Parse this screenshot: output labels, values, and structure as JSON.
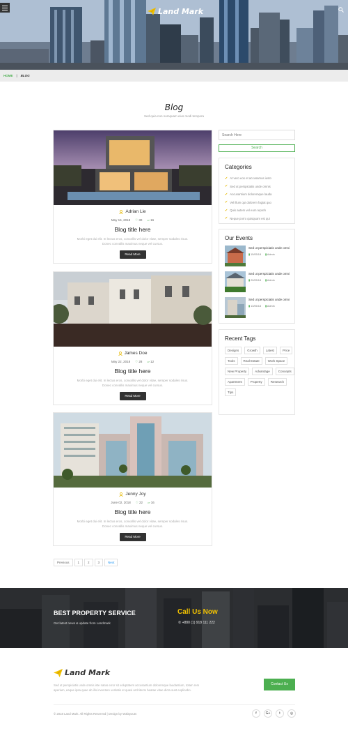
{
  "header": {
    "logo_text": "Land Mark",
    "menu_icon": "hamburger-icon",
    "search_icon": "search-icon"
  },
  "breadcrumb": {
    "home": "HOME",
    "separator": "|",
    "current": "BLOG"
  },
  "page": {
    "title": "Blog",
    "subtitle": "Sed quia non numquam eius modi tempora"
  },
  "posts": [
    {
      "author": "Adrian Lie",
      "date": "May 15, 2018",
      "likes": "30",
      "comments": "16",
      "title": "Blog title here",
      "excerpt": "Morbi eget dui elit. In lectus eros, convallis vel dolor vitae, semper sodales risus. Donec convallis maximus neque vel cursus.",
      "read_more": "Read More"
    },
    {
      "author": "James Doe",
      "date": "May 22, 2018",
      "likes": "28",
      "comments": "12",
      "title": "Blog title here",
      "excerpt": "Morbi eget dui elit. In lectus eros, convallis vel dolor vitae, semper sodales risus. Donec convallis maximus neque vel cursus.",
      "read_more": "Read More"
    },
    {
      "author": "Jenny Joy",
      "date": "June 02, 2018",
      "likes": "22",
      "comments": "16",
      "title": "Blog title here",
      "excerpt": "Morbi eget dui elit. In lectus eros, convallis vel dolor vitae, semper sodales risus. Donec convallis maximus neque vel cursus.",
      "read_more": "Read More"
    }
  ],
  "sidebar": {
    "search_placeholder": "Search Here",
    "search_button": "Search",
    "categories_title": "Categories",
    "categories": [
      "At vero eos et accusamus iusto",
      "Sed ut perspiciatis unde omnis",
      "Accusantium doloremque lauda",
      "Vel illum qui dolorem fugiat quo",
      "Quis autem vel eum repreh",
      "Neque porro quisquam est qui"
    ],
    "events_title": "Our Events",
    "events": [
      {
        "title": "Sed ut perspiciatis unde omni",
        "date": "15/05/18",
        "user": "Admin"
      },
      {
        "title": "Sed ut perspiciatis unde omni",
        "date": "20/05/18",
        "user": "Admin"
      },
      {
        "title": "Sed ut perspiciatis unde omni",
        "date": "13/06/18",
        "user": "Admin"
      }
    ],
    "tags_title": "Recent Tags",
    "tags": [
      "Designs",
      "Growth",
      "Latest",
      "Price",
      "Tools",
      "Real Estate",
      "Work Space",
      "New Property",
      "Advantage",
      "Concepts",
      "Apartment",
      "Property",
      "Research",
      "Tips"
    ]
  },
  "pagination": {
    "previous": "Previous",
    "pages": [
      "1",
      "2",
      "3"
    ],
    "next": "Next"
  },
  "banner": {
    "title": "BEST PROPERTY SERVICE",
    "subtitle": "Get latest news & update from Landmark",
    "call_label": "Call Us Now",
    "phone": "+880 (1) 918 111 222"
  },
  "footer": {
    "logo_text": "Land Mark",
    "description": "Sed ut perspiciatis unde omnis iste natus error sit voluptatem accusantium doloremque laudantium, totam rem aperiam, eaque ipsa quae ab illo inventore veritatis et quasi architecto beatae vitae dicta sunt explicabo.",
    "contact_button": "Contact Us",
    "copyright": "© 2018 Land Mark. All Rights Reserved | Design by W3layouts",
    "social": [
      "f",
      "G+",
      "t",
      "◎"
    ]
  },
  "colors": {
    "accent": "#4caf50",
    "brand_yellow": "#f2c200",
    "dark": "#333333"
  }
}
